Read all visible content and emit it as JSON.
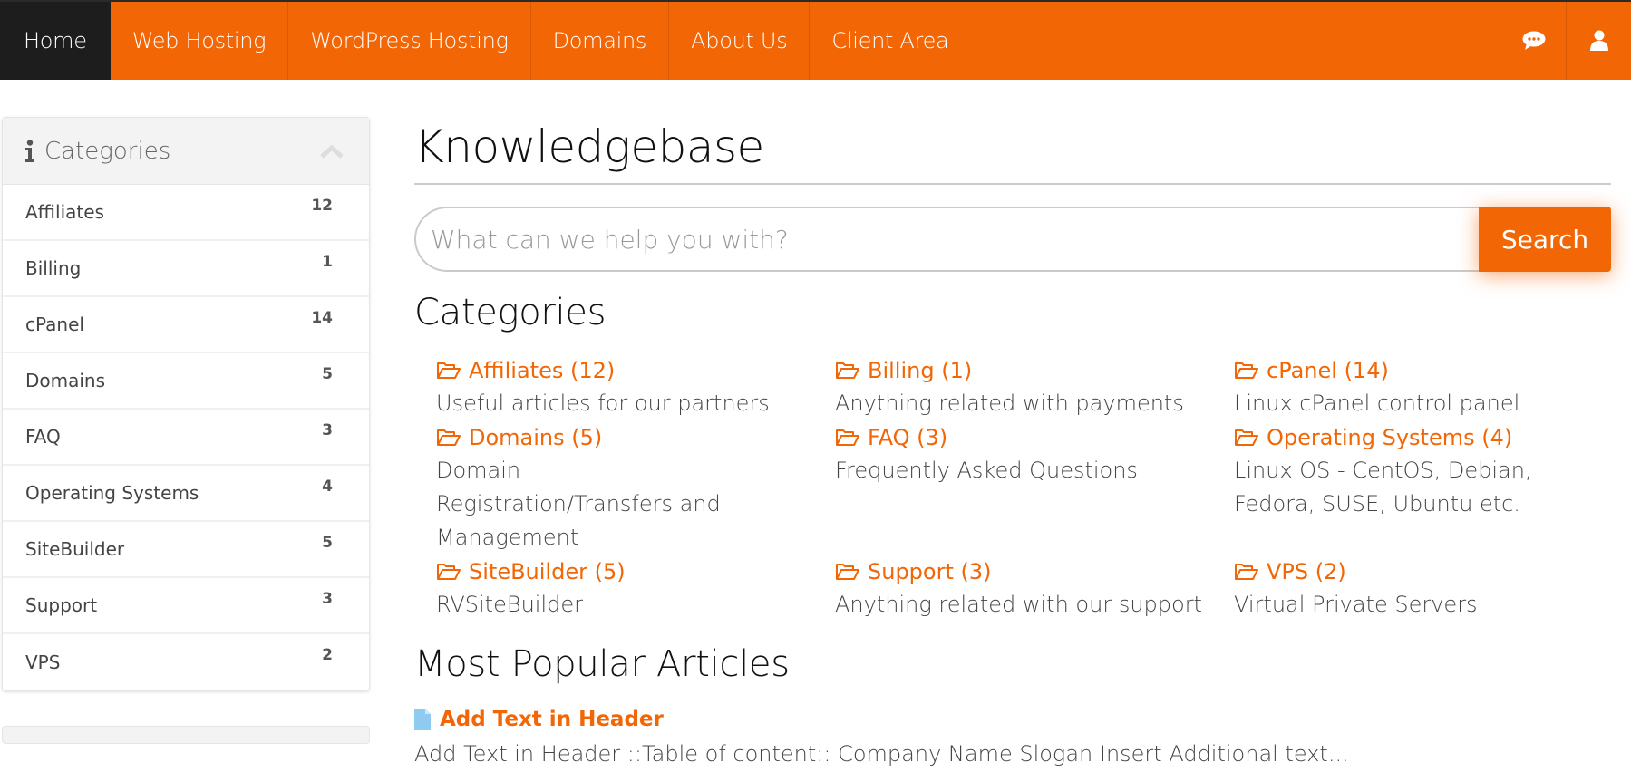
{
  "nav": {
    "items": [
      {
        "label": "Home",
        "active": true
      },
      {
        "label": "Web Hosting",
        "active": false
      },
      {
        "label": "WordPress Hosting",
        "active": false
      },
      {
        "label": "Domains",
        "active": false
      },
      {
        "label": "About Us",
        "active": false
      },
      {
        "label": "Client Area",
        "active": false
      }
    ],
    "icons": [
      "chat-icon",
      "user-icon"
    ]
  },
  "sidebar": {
    "title": "Categories",
    "items": [
      {
        "label": "Affiliates",
        "count": "12"
      },
      {
        "label": "Billing",
        "count": "1"
      },
      {
        "label": "cPanel",
        "count": "14"
      },
      {
        "label": "Domains",
        "count": "5"
      },
      {
        "label": "FAQ",
        "count": "3"
      },
      {
        "label": "Operating Systems",
        "count": "4"
      },
      {
        "label": "SiteBuilder",
        "count": "5"
      },
      {
        "label": "Support",
        "count": "3"
      },
      {
        "label": "VPS",
        "count": "2"
      }
    ]
  },
  "main": {
    "title": "Knowledgebase",
    "search": {
      "placeholder": "What can we help you with?",
      "button": "Search"
    },
    "categories_title": "Categories",
    "categories": [
      {
        "name": "Affiliates (12)",
        "desc": "Useful articles for our partners"
      },
      {
        "name": "Billing (1)",
        "desc": "Anything related with payments"
      },
      {
        "name": "cPanel (14)",
        "desc": "Linux cPanel control panel"
      },
      {
        "name": "Domains (5)",
        "desc": "Domain Registration/Transfers and Management"
      },
      {
        "name": "FAQ (3)",
        "desc": "Frequently Asked Questions"
      },
      {
        "name": "Operating Systems (4)",
        "desc": "Linux OS - CentOS, Debian, Fedora, SUSE, Ubuntu etc."
      },
      {
        "name": "SiteBuilder (5)",
        "desc": "RVSiteBuilder"
      },
      {
        "name": "Support (3)",
        "desc": "Anything related with our support"
      },
      {
        "name": "VPS (2)",
        "desc": "Virtual Private Servers"
      }
    ],
    "popular_title": "Most Popular Articles",
    "articles": [
      {
        "title": "Add Text in Header",
        "excerpt": "Add Text in Header ::Table of content:: Company Name Slogan Insert Additional text..."
      }
    ]
  },
  "colors": {
    "accent": "#f26605",
    "nav_active": "#1d1d1d",
    "article_icon": "#8fcbf0"
  }
}
